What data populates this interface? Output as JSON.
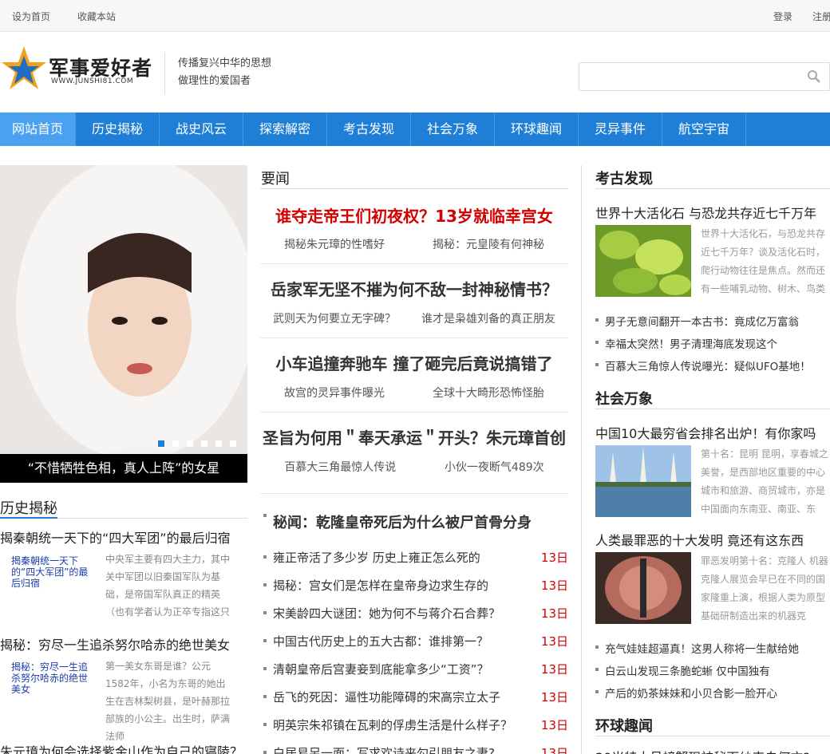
{
  "topbar": {
    "set_home": "设为首页",
    "bookmark": "收藏本站",
    "login": "登录",
    "register": "注册"
  },
  "header": {
    "logo_text": "军事爱好者",
    "logo_url": "WWW.JUNSHI81.COM",
    "slogan_line1": "传播复兴中华的思想",
    "slogan_line2": "做理性的爱国者",
    "search_placeholder": ""
  },
  "nav": [
    "网站首页",
    "历史揭秘",
    "战史风云",
    "探索解密",
    "考古发现",
    "社会万象",
    "环球趣闻",
    "灵异事件",
    "航空宇宙"
  ],
  "slideshow": {
    "caption": "“不惜牺牲色相，真人上阵”的女星",
    "dot_count": 6,
    "active_dot": 1
  },
  "left": {
    "section_title": "历史揭秘",
    "items": [
      {
        "title": "揭秦朝统一天下的“四大军团”的最后归宿",
        "thumb_label": "揭秦朝统一天下的“四大军团”的最后归宿",
        "summary": "中央军主要有四大主力，其中关中军团以旧秦国军队为基础，是帝国军队真正的精英（也有学者认为正卒专指这只"
      },
      {
        "title": "揭秘：穷尽一生追杀努尔哈赤的绝世美女",
        "thumb_label": "揭秘：穷尽一生追杀努尔哈赤的绝世美女",
        "summary": "第一美女东哥是谁？公元1582年，小名为东哥的她出生在吉林梨树县，是叶赫那拉部族的小公主。出生时，萨满法师"
      }
    ],
    "last_title": "朱元璋为何会选择紫金山作为自己的寝陵？"
  },
  "middle": {
    "section_title": "要闻",
    "headlines": [
      {
        "title": "谁夺走帝王们初夜权？13岁就临幸宫女",
        "red": true,
        "subs": [
          "揭秘朱元璋的性嗜好",
          "揭秘：元皇陵有何神秘"
        ]
      },
      {
        "title": "岳家军无坚不摧为何不敌一封神秘情书？",
        "red": false,
        "subs": [
          "武则天为何要立无字碑？",
          "谁才是枭雄刘备的真正朋友"
        ]
      },
      {
        "title": "小车追撞奔驰车 撞了砸完后竟说搞错了",
        "red": false,
        "subs": [
          "故宫的灵异事件曝光",
          "全球十大畸形恐怖怪胎"
        ]
      },
      {
        "title": "圣旨为何用＂奉天承运＂开头？朱元璋首创",
        "red": false,
        "subs": [
          "百慕大三角最惊人传说",
          "小伙一夜断气489次"
        ]
      }
    ],
    "secret_title": "秘闻：乾隆皇帝死后为什么被尸首骨分身",
    "list": [
      {
        "title": "雍正帝活了多少岁 历史上雍正怎么死的",
        "date": "13日"
      },
      {
        "title": "揭秘：宫女们是怎样在皇帝身边求生存的",
        "date": "13日"
      },
      {
        "title": "宋美龄四大谜团：她为何不与蒋介石合葬？",
        "date": "13日"
      },
      {
        "title": "中国古代历史上的五大古都：谁排第一？",
        "date": "13日"
      },
      {
        "title": "清朝皇帝后宫妻妾到底能拿多少“工资”？",
        "date": "13日"
      },
      {
        "title": "岳飞的死因：逼性功能障碍的宋高宗立太子",
        "date": "13日"
      },
      {
        "title": "明英宗朱祁镇在瓦剌的俘虏生活是什么样子？",
        "date": "13日"
      },
      {
        "title": "白居易另一面：写求欢诗来勾引朋友之妻?",
        "date": "13日"
      }
    ]
  },
  "right": {
    "archaeology": {
      "section_title": "考古发现",
      "feature_title": "世界十大活化石 与恐龙共存近七千万年",
      "feature_text": "世界十大活化石，与恐龙共存近七千万年？谈及活化石时，爬行动物往往是焦点。然而还有一些哺乳动物、树木、鸟类",
      "list": [
        "男子无意间翻开一本古书：竟成亿万富翁",
        "幸福太突然！男子清理海底发现这个",
        "百慕大三角惊人传说曝光：疑似UFO基地！"
      ]
    },
    "society": {
      "section_title": "社会万象",
      "feature1_title": "中国10大最穷省会排名出炉！有你家吗",
      "feature1_text": "第十名：昆明 昆明，享春城之美誉，是西部地区重要的中心城市和旅游、商贸城市，亦是中国面向东南亚、南亚、东",
      "feature2_title": "人类最罪恶的十大发明 竟还有这东西",
      "feature2_text": "罪恶发明第十名：克隆人 机器克隆人展览会早已在不同的国家隆重上演，根据人类为原型基础研制造出来的机器克",
      "list": [
        "充气娃娃超逼真！这男人称将一生献给她",
        "白云山发现三条脆蛇蜥 仅中国独有",
        "产后的奶茶妹妹和小贝合影一脸开心"
      ]
    },
    "world": {
      "section_title": "环球趣闻",
      "first_title": "20米特大号螃蟹现神秘面纱来自何方?"
    }
  },
  "colors": {
    "nav_bg": "#1f7fd6",
    "nav_active": "#4aa1ef",
    "headline_red": "#d40000"
  }
}
